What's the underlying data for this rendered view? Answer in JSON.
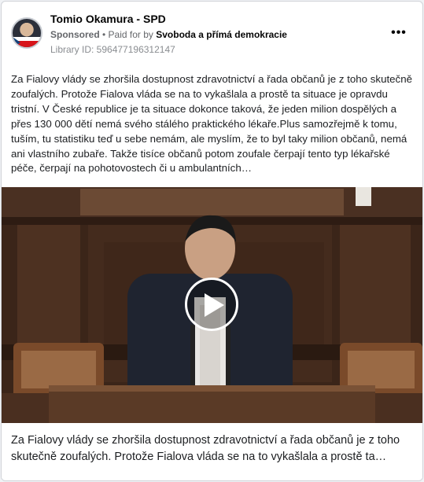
{
  "post": {
    "page_name": "Tomio Okamura - SPD",
    "sponsored_label": "Sponsored",
    "separator": " • ",
    "paid_for_label": "Paid for by ",
    "funder": "Svoboda a přímá demokracie",
    "library_id": "Library ID: 596477196312147",
    "more_label": "•••",
    "body_text": "Za Fialovy vlády se zhoršila dostupnost zdravotnictví a řada občanů je z toho skutečně zoufalých. Protože Fialova vláda se na to vykašlala a prostě ta situace je opravdu tristní. V České republice je ta situace dokonce taková, že jeden milion dospělých a přes 130 000 dětí nemá svého stálého praktického lékaře.Plus samozřejmě k tomu, tuším, tu statistiku teď u sebe nemám, ale myslím, že to byl taky milion občanů, nemá ani vlastního zubaře. Takže tisíce občanů potom zoufale čerpají tento typ lékařské péče, čerpají na pohotovostech či u ambulantních…",
    "caption_text": "Za Fialovy vlády se zhoršila dostupnost zdravotnictví a řada občanů je z toho skutečně zoufalých. Protože Fialova vláda se na to vykašlala a prostě ta situace je opravdu tristní."
  },
  "icons": {
    "more": "more-options-icon",
    "play": "play-icon"
  },
  "colors": {
    "text_primary": "#050505",
    "text_secondary": "#65676b",
    "flag_red": "#d7141a",
    "flag_blue": "#11457e"
  }
}
